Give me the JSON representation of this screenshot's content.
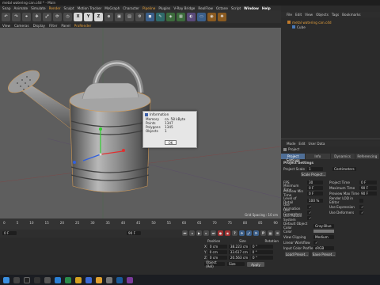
{
  "window": {
    "title": "metal watering can.c4d * - Main"
  },
  "menubar": {
    "items": [
      "Snap",
      "Animate",
      "Simulate",
      "Render",
      "Sculpt",
      "Motion Tracker",
      "MoGraph",
      "Character",
      "Pipeline",
      "Plugins",
      "V-Ray Bridge",
      "RealFlow",
      "Octane",
      "Script",
      "Window",
      "Help"
    ]
  },
  "view_menu": {
    "items": [
      "View",
      "Cameras",
      "Display",
      "Filter",
      "Panel",
      "ProRender"
    ]
  },
  "toolbar": {
    "axis_labels": [
      "X",
      "Y",
      "Z"
    ]
  },
  "viewport": {
    "grid_spacing": "Grid Spacing : 10 cm"
  },
  "info_dialog": {
    "title": "Information",
    "rows": [
      {
        "key": "Memory",
        "value": "ca. 58 kByte"
      },
      {
        "key": "Points",
        "value": "1347"
      },
      {
        "key": "Polygons",
        "value": "1345"
      },
      {
        "key": "Objects",
        "value": "1"
      }
    ],
    "ok": "OK"
  },
  "object_manager": {
    "menu": [
      "File",
      "Edit",
      "View",
      "Objects",
      "Tags",
      "Bookmarks"
    ],
    "objects": [
      "metal watering can.c4d",
      "Cube"
    ]
  },
  "attributes": {
    "menu": [
      "Mode",
      "Edit",
      "User Data"
    ],
    "header": "Project",
    "tabs": [
      "Project Settings",
      "Info",
      "Dynamics",
      "Referencing"
    ],
    "section": "Project Settings",
    "fields": [
      {
        "label": "Project Scale",
        "value": "1",
        "unit": "Centimeters"
      },
      {
        "label": "FPS",
        "value": "30",
        "label2": "Project Time",
        "value2": "0 F"
      },
      {
        "label": "Minimum Time",
        "value": "0 F",
        "label2": "Maximum Time",
        "value2": "90 F"
      },
      {
        "label": "Preview Min Time",
        "value": "0 F",
        "label2": "Preview Max Time",
        "value2": "90 F"
      },
      {
        "label": "Level of Detail",
        "value": "100 %",
        "label2": "Render LOD in Editor",
        "value2": ""
      },
      {
        "label": "Use Animation",
        "value": "",
        "label2": "Use Expression",
        "value2": ""
      },
      {
        "label": "Use Generators",
        "value": "",
        "label2": "Use Deformers",
        "value2": ""
      },
      {
        "label": "Use Motion System",
        "value": ""
      }
    ],
    "apply_scale": "Scale Project...",
    "lower": [
      {
        "label": "Default Object Color",
        "value": "Gray-Blue"
      },
      {
        "label": "Color",
        "value": ""
      },
      {
        "label": "View Clipping",
        "value": "Medium"
      },
      {
        "label": "Linear Workflow",
        "value": ""
      },
      {
        "label": "Input Color Profile",
        "value": "sRGB"
      }
    ],
    "buttons": [
      "Load Preset...",
      "Save Preset..."
    ]
  },
  "timeline": {
    "ticks": [
      "0",
      "5",
      "10",
      "15",
      "20",
      "25",
      "30",
      "35",
      "40",
      "45",
      "50",
      "55",
      "60",
      "65",
      "70",
      "75",
      "80",
      "85",
      "90"
    ],
    "current": "0 F",
    "end": "90 F"
  },
  "coordinates": {
    "headers": [
      "Position",
      "Size",
      "Rotation"
    ],
    "rows": [
      {
        "axis": "X",
        "pos": "0 cm",
        "size": "38.223 cm",
        "rot": "0 °"
      },
      {
        "axis": "Y",
        "pos": "0 cm",
        "size": "33.617 cm",
        "rot": "0 °"
      },
      {
        "axis": "Z",
        "pos": "0 cm",
        "size": "20.563 cm",
        "rot": "0 °"
      }
    ],
    "mode": "Object (Rel)",
    "size_mode": "Size",
    "apply": "Apply"
  },
  "colors": {
    "accent": "#e9a23b",
    "tab_active": "#4f6e96",
    "viewport": "#5e5e5e"
  }
}
